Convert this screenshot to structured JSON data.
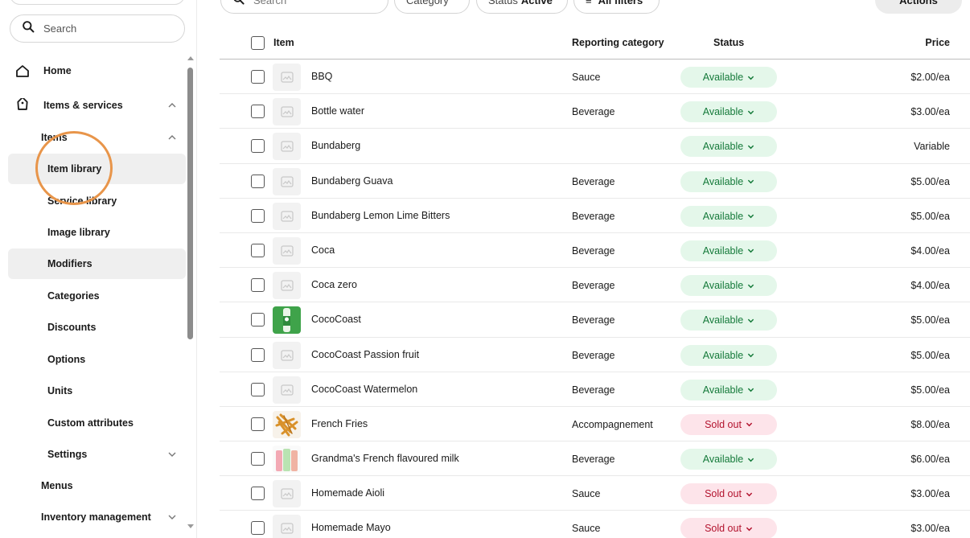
{
  "sidebar": {
    "search_placeholder": "Search",
    "nav": [
      {
        "label": "Home"
      },
      {
        "label": "Items & services"
      },
      {
        "label": "Items"
      },
      {
        "label": "Item library"
      },
      {
        "label": "Service library"
      },
      {
        "label": "Image library"
      },
      {
        "label": "Modifiers"
      },
      {
        "label": "Categories"
      },
      {
        "label": "Discounts"
      },
      {
        "label": "Options"
      },
      {
        "label": "Units"
      },
      {
        "label": "Custom attributes"
      },
      {
        "label": "Settings"
      },
      {
        "label": "Menus"
      },
      {
        "label": "Inventory management"
      }
    ]
  },
  "toolbar": {
    "search_placeholder": "Search",
    "category_label": "Category",
    "status_label": "Status",
    "status_value": "Active",
    "all_filters_label": "All filters",
    "actions_label": "Actions"
  },
  "table": {
    "headers": {
      "item": "Item",
      "reporting_category": "Reporting category",
      "status": "Status",
      "price": "Price"
    },
    "rows": [
      {
        "name": "BBQ",
        "category": "Sauce",
        "status": "Available",
        "status_type": "available",
        "price": "$2.00/ea",
        "thumb": "placeholder"
      },
      {
        "name": "Bottle water",
        "category": "Beverage",
        "status": "Available",
        "status_type": "available",
        "price": "$3.00/ea",
        "thumb": "placeholder"
      },
      {
        "name": "Bundaberg",
        "category": "",
        "status": "Available",
        "status_type": "available",
        "price": "Variable",
        "thumb": "placeholder"
      },
      {
        "name": "Bundaberg Guava",
        "category": "Beverage",
        "status": "Available",
        "status_type": "available",
        "price": "$5.00/ea",
        "thumb": "placeholder"
      },
      {
        "name": "Bundaberg Lemon Lime Bitters",
        "category": "Beverage",
        "status": "Available",
        "status_type": "available",
        "price": "$5.00/ea",
        "thumb": "placeholder"
      },
      {
        "name": "Coca",
        "category": "Beverage",
        "status": "Available",
        "status_type": "available",
        "price": "$4.00/ea",
        "thumb": "placeholder"
      },
      {
        "name": "Coca zero",
        "category": "Beverage",
        "status": "Available",
        "status_type": "available",
        "price": "$4.00/ea",
        "thumb": "placeholder"
      },
      {
        "name": "CocoCoast",
        "category": "Beverage",
        "status": "Available",
        "status_type": "available",
        "price": "$5.00/ea",
        "thumb": "green-bottle"
      },
      {
        "name": "CocoCoast Passion fruit",
        "category": "Beverage",
        "status": "Available",
        "status_type": "available",
        "price": "$5.00/ea",
        "thumb": "placeholder"
      },
      {
        "name": "CocoCoast Watermelon",
        "category": "Beverage",
        "status": "Available",
        "status_type": "available",
        "price": "$5.00/ea",
        "thumb": "placeholder"
      },
      {
        "name": "French Fries",
        "category": "Accompagnement",
        "status": "Sold out",
        "status_type": "soldout",
        "price": "$8.00/ea",
        "thumb": "fries"
      },
      {
        "name": "Grandma's French flavoured milk",
        "category": "Beverage",
        "status": "Available",
        "status_type": "available",
        "price": "$6.00/ea",
        "thumb": "milk-bottles"
      },
      {
        "name": "Homemade Aioli",
        "category": "Sauce",
        "status": "Sold out",
        "status_type": "soldout",
        "price": "$3.00/ea",
        "thumb": "placeholder"
      },
      {
        "name": "Homemade Mayo",
        "category": "Sauce",
        "status": "Sold out",
        "status_type": "soldout",
        "price": "$3.00/ea",
        "thumb": "placeholder"
      }
    ]
  }
}
